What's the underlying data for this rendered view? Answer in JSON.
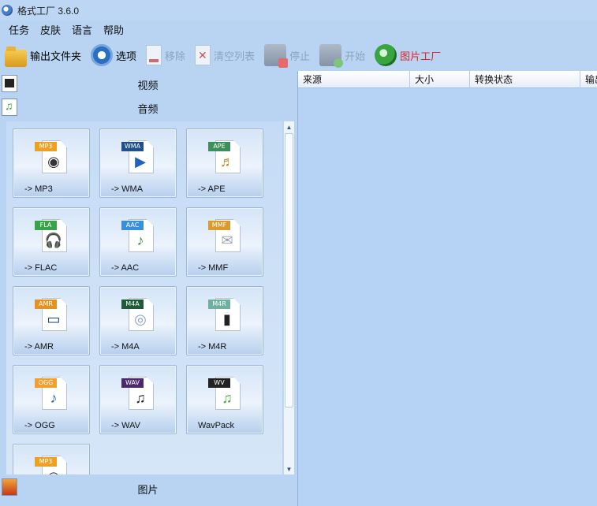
{
  "window": {
    "title": "格式工厂 3.6.0"
  },
  "menu": [
    "任务",
    "皮肤",
    "语言",
    "帮助"
  ],
  "toolbar": {
    "output_folder": "输出文件夹",
    "options": "选项",
    "remove": "移除",
    "clear_list": "清空列表",
    "stop": "停止",
    "start": "开始",
    "picture_factory": "图片工厂"
  },
  "categories": {
    "video": "视频",
    "audio": "音频",
    "picture": "图片"
  },
  "tiles": [
    {
      "badge": "MP3",
      "badge_color": "#f0a020",
      "glyph": "◉",
      "glyph_color": "#333",
      "label": "-> MP3"
    },
    {
      "badge": "WMA",
      "badge_color": "#1f4f8c",
      "glyph": "▶",
      "glyph_color": "#1d62c2",
      "label": "-> WMA"
    },
    {
      "badge": "APE",
      "badge_color": "#3b8f5a",
      "glyph": "♬",
      "glyph_color": "#b58a2a",
      "label": "-> APE"
    },
    {
      "badge": "FLA",
      "badge_color": "#3aa24b",
      "glyph": "🎧",
      "glyph_color": "#222",
      "label": "-> FLAC"
    },
    {
      "badge": "AAC",
      "badge_color": "#3a8fd8",
      "glyph": "♪",
      "glyph_color": "#3a8a3a",
      "label": "-> AAC"
    },
    {
      "badge": "MMF",
      "badge_color": "#d99a30",
      "glyph": "✉",
      "glyph_color": "#9aa4b0",
      "label": "-> MMF"
    },
    {
      "badge": "AMR",
      "badge_color": "#e89020",
      "glyph": "▭",
      "glyph_color": "#1b3f6e",
      "label": "-> AMR"
    },
    {
      "badge": "M4A",
      "badge_color": "#1f5a3a",
      "glyph": "◎",
      "glyph_color": "#8aa0c0",
      "label": "-> M4A"
    },
    {
      "badge": "M4R",
      "badge_color": "#6fb0a0",
      "glyph": "▮",
      "glyph_color": "#222",
      "label": "-> M4R"
    },
    {
      "badge": "OGG",
      "badge_color": "#f0a030",
      "glyph": "♪",
      "glyph_color": "#1d62c2",
      "label": "-> OGG"
    },
    {
      "badge": "WAV",
      "badge_color": "#4a2a6a",
      "glyph": "♫",
      "glyph_color": "#222",
      "label": "-> WAV"
    },
    {
      "badge": "WV",
      "badge_color": "#222222",
      "glyph": "♫",
      "glyph_color": "#4aa63a",
      "label": "WavPack"
    },
    {
      "badge": "MP3",
      "badge_color": "#f0a020",
      "glyph": "◉",
      "glyph_color": "#333",
      "label": ""
    }
  ],
  "columns": [
    "来源",
    "大小",
    "转换状态",
    "输出"
  ]
}
